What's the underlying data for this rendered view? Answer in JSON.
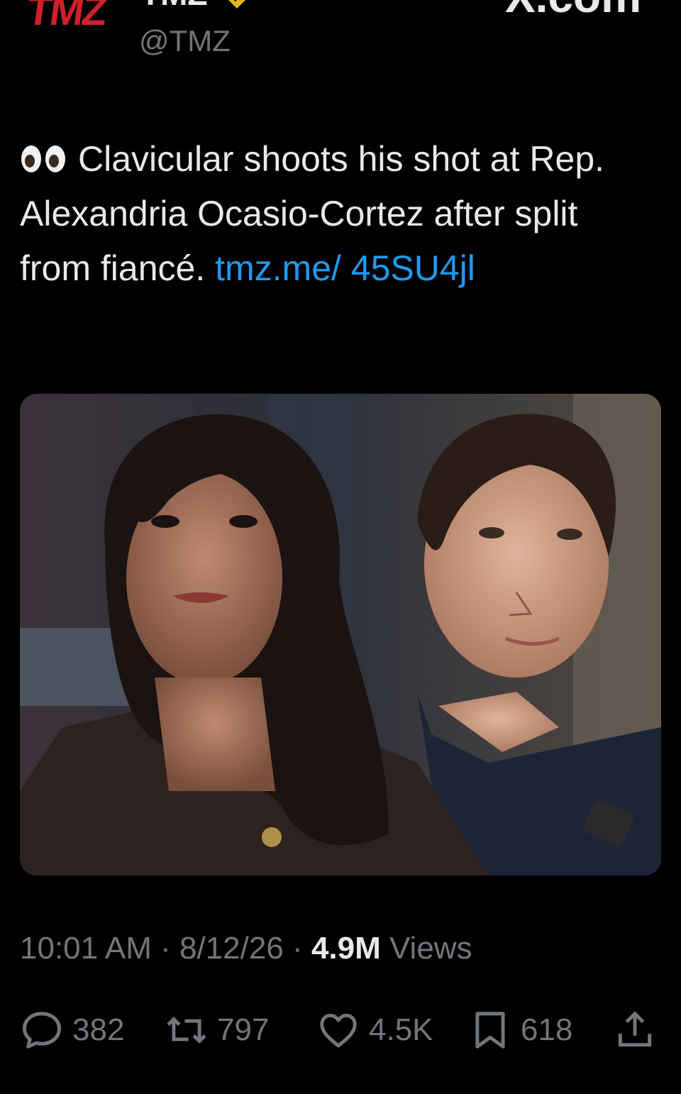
{
  "header": {
    "logo_text": "TMZ",
    "display_name": "TMZ",
    "handle": "@TMZ",
    "source_domain": "X.com",
    "verified_badge_color": "#e2b719",
    "brand_color": "#d0202a"
  },
  "tweet": {
    "emoji_icon": "eyes-emoji-icon",
    "text": "Clavicular shoots his shot at Rep. Alexandria Ocasio-Cortez after split from fiancé. ",
    "link": "tmz.me/ 45SU4jl",
    "link_color": "#1d9bf0"
  },
  "meta": {
    "time": "10:01 AM",
    "sep1": " · ",
    "date": "8/12/26",
    "sep2": " · ",
    "views_count": "4.9M",
    "views_label": " Views"
  },
  "actions": {
    "reply": {
      "icon": "reply-bubble-icon",
      "count": "382"
    },
    "repost": {
      "icon": "repost-icon",
      "count": "797"
    },
    "like": {
      "icon": "heart-icon",
      "count": "4.5K"
    },
    "bookmark": {
      "icon": "bookmark-icon",
      "count": "618"
    },
    "share": {
      "icon": "share-icon"
    }
  }
}
